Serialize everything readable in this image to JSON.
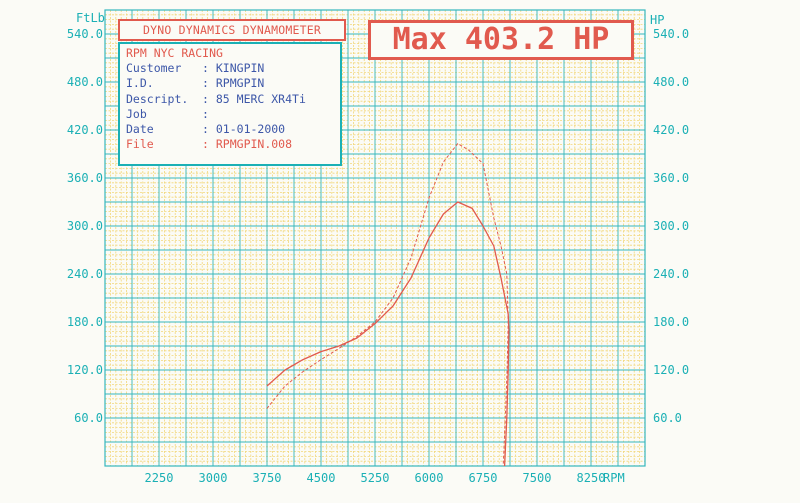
{
  "header": {
    "title": "DYNO DYNAMICS DYNAMOMETER",
    "max_label": "Max 403.2 HP"
  },
  "info": {
    "shop": "RPM NYC RACING",
    "rows": [
      {
        "label": "Customer",
        "sep": ":",
        "value": "KINGPIN"
      },
      {
        "label": "I.D.",
        "sep": ":",
        "value": "RPMGPIN"
      },
      {
        "label": "Descript.",
        "sep": ":",
        "value": "85 MERC XR4Ti"
      },
      {
        "label": "Job",
        "sep": ":",
        "value": ""
      },
      {
        "label": "Date",
        "sep": ":",
        "value": "01-01-2000"
      },
      {
        "label": "File",
        "sep": ":",
        "value": "RPMGPIN.008"
      }
    ]
  },
  "colors": {
    "grid_minor": "#f2d77a",
    "grid_major": "#35b7bd",
    "axis_text": "#1bb0b5",
    "curve": "#e15a4e",
    "info_text": "#3d57a8"
  },
  "chart_data": {
    "type": "line",
    "left_axis_label": "FtLb",
    "right_axis_label": "HP",
    "xlabel": "RPM",
    "xlim": [
      1500,
      9000
    ],
    "ylim": [
      0,
      570
    ],
    "x_ticks": [
      2250,
      3000,
      3750,
      4500,
      5250,
      6000,
      6750,
      7500,
      8250
    ],
    "y_ticks_left": [
      "60.0",
      "120.0",
      "180.0",
      "240.0",
      "300.0",
      "360.0",
      "420.0",
      "480.0",
      "540.0"
    ],
    "y_ticks_right": [
      "60.0",
      "120.0",
      "180.0",
      "240.0",
      "300.0",
      "360.0",
      "420.0",
      "480.0",
      "540.0"
    ],
    "grid": true,
    "series": [
      {
        "style": "solid",
        "points": [
          [
            3750,
            100
          ],
          [
            4000,
            120
          ],
          [
            4250,
            133
          ],
          [
            4500,
            143
          ],
          [
            4750,
            150
          ],
          [
            5000,
            160
          ],
          [
            5250,
            178
          ],
          [
            5500,
            200
          ],
          [
            5750,
            235
          ],
          [
            6000,
            285
          ],
          [
            6200,
            315
          ],
          [
            6400,
            330
          ],
          [
            6600,
            322
          ],
          [
            6750,
            300
          ],
          [
            6900,
            275
          ],
          [
            7000,
            235
          ],
          [
            7100,
            190
          ],
          [
            7110,
            170
          ],
          [
            7100,
            120
          ],
          [
            7080,
            60
          ],
          [
            7050,
            0
          ]
        ]
      },
      {
        "style": "dashed",
        "points": [
          [
            3750,
            72
          ],
          [
            4000,
            100
          ],
          [
            4250,
            118
          ],
          [
            4500,
            133
          ],
          [
            4750,
            147
          ],
          [
            5000,
            162
          ],
          [
            5250,
            180
          ],
          [
            5500,
            210
          ],
          [
            5750,
            260
          ],
          [
            6000,
            335
          ],
          [
            6200,
            380
          ],
          [
            6400,
            403
          ],
          [
            6550,
            395
          ],
          [
            6750,
            378
          ],
          [
            6900,
            310
          ],
          [
            7000,
            275
          ],
          [
            7080,
            240
          ],
          [
            7100,
            180
          ],
          [
            7085,
            120
          ],
          [
            7060,
            60
          ],
          [
            7030,
            0
          ]
        ]
      }
    ]
  }
}
